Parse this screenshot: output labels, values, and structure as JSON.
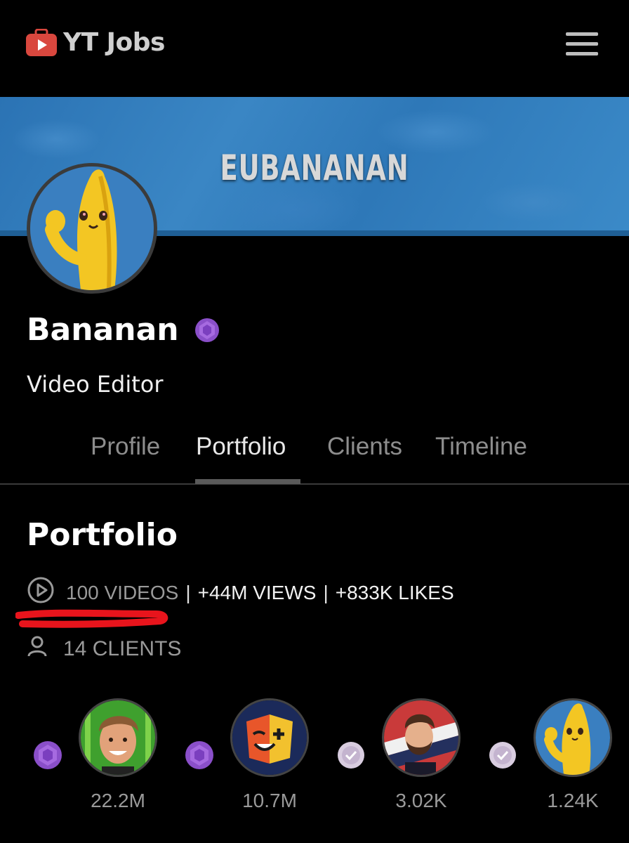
{
  "app": {
    "name": "YT Jobs"
  },
  "banner": {
    "title": "EUBANANAN"
  },
  "profile": {
    "name": "Bananan",
    "role": "Video Editor"
  },
  "tabs": [
    {
      "label": "Profile",
      "active": false
    },
    {
      "label": "Portfolio",
      "active": true
    },
    {
      "label": "Clients",
      "active": false
    },
    {
      "label": "Timeline",
      "active": false
    }
  ],
  "portfolio": {
    "title": "Portfolio",
    "videos": "100 VIDEOS",
    "separator": "|",
    "views": "+44M VIEWS",
    "likes": "+833K LIKES",
    "clients": "14 CLIENTS"
  },
  "client_list": [
    {
      "count": "22.2M",
      "badge": "purple-gem-icon"
    },
    {
      "count": "10.7M",
      "badge": "purple-gem-icon"
    },
    {
      "count": "3.02K",
      "badge": "verified-check-icon"
    },
    {
      "count": "1.24K",
      "badge": "verified-check-icon"
    }
  ],
  "colors": {
    "background": "#000000",
    "banner": "#2f7bbd",
    "gem": "#8a4fc9",
    "annotation": "#e8141c",
    "muted": "#9a9a9a"
  }
}
